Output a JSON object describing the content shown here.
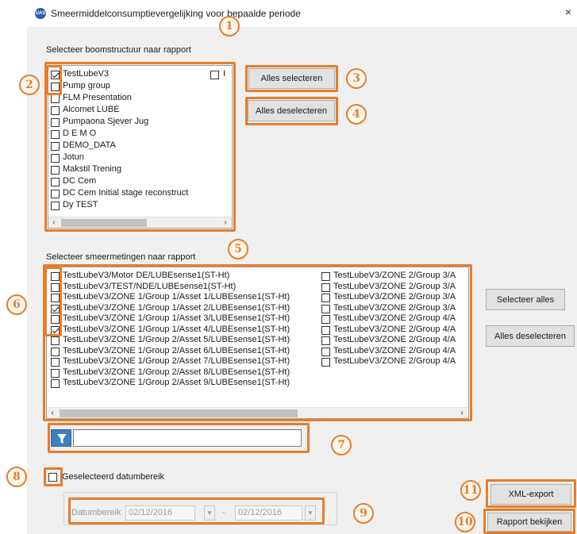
{
  "window": {
    "title": "Smeermiddelconsumptievergelijking voor bepaalde periode",
    "icon_text": "UAS",
    "close_glyph": "×"
  },
  "tree": {
    "label": "Selecteer boomstructuur naar rapport",
    "items": [
      {
        "label": "TestLubeV3",
        "checked": true
      },
      {
        "label": "Pump group",
        "checked": false
      },
      {
        "label": "FLM Presentation",
        "checked": false
      },
      {
        "label": "Alcomet LUBE",
        "checked": false
      },
      {
        "label": "Pumpaona Sjever Jug",
        "checked": false
      },
      {
        "label": "D E M O",
        "checked": false
      },
      {
        "label": "DEMO_DATA",
        "checked": false
      },
      {
        "label": "Jotun",
        "checked": false
      },
      {
        "label": "Makstil Trening",
        "checked": false
      },
      {
        "label": "DC Cem",
        "checked": false
      },
      {
        "label": "DC Cem Initial stage reconstruct",
        "checked": false
      },
      {
        "label": "Dy TEST",
        "checked": false
      }
    ],
    "extra_item": {
      "label": "I",
      "checked": false
    },
    "select_all_button": "Alles selecteren",
    "deselect_all_button": "Alles deselecteren"
  },
  "measurements": {
    "label": "Selecteer smeermetingen naar rapport",
    "left_column": [
      {
        "label": "TestLubeV3/Motor DE/LUBEsense1(ST-Ht)",
        "checked": false
      },
      {
        "label": "TestLubeV3/TEST/NDE/LUBEsense1(ST-Ht)",
        "checked": false
      },
      {
        "label": "TestLubeV3/ZONE 1/Group 1/Asset 1/LUBEsense1(ST-Ht)",
        "checked": false
      },
      {
        "label": "TestLubeV3/ZONE 1/Group 1/Asset 2/LUBEsense1(ST-Ht)",
        "checked": true
      },
      {
        "label": "TestLubeV3/ZONE 1/Group 1/Asset 3/LUBEsense1(ST-Ht)",
        "checked": false
      },
      {
        "label": "TestLubeV3/ZONE 1/Group 1/Asset 4/LUBEsense1(ST-Ht)",
        "checked": true
      },
      {
        "label": "TestLubeV3/ZONE 1/Group 2/Asset 5/LUBEsense1(ST-Ht)",
        "checked": false
      },
      {
        "label": "TestLubeV3/ZONE 1/Group 2/Asset 6/LUBEsense1(ST-Ht)",
        "checked": false
      },
      {
        "label": "TestLubeV3/ZONE 1/Group 2/Asset 7/LUBEsense1(ST-Ht)",
        "checked": false
      },
      {
        "label": "TestLubeV3/ZONE 1/Group 2/Asset 8/LUBEsense1(ST-Ht)",
        "checked": false
      },
      {
        "label": "TestLubeV3/ZONE 1/Group 2/Asset 9/LUBEsense1(ST-Ht)",
        "checked": false
      }
    ],
    "right_column": [
      {
        "label": "TestLubeV3/ZONE 2/Group 3/A",
        "checked": false
      },
      {
        "label": "TestLubeV3/ZONE 2/Group 3/A",
        "checked": false
      },
      {
        "label": "TestLubeV3/ZONE 2/Group 3/A",
        "checked": false
      },
      {
        "label": "TestLubeV3/ZONE 2/Group 3/A",
        "checked": false
      },
      {
        "label": "TestLubeV3/ZONE 2/Group 4/A",
        "checked": false
      },
      {
        "label": "TestLubeV3/ZONE 2/Group 4/A",
        "checked": false
      },
      {
        "label": "TestLubeV3/ZONE 2/Group 4/A",
        "checked": false
      },
      {
        "label": "TestLubeV3/ZONE 2/Group 4/A",
        "checked": false
      },
      {
        "label": "TestLubeV3/ZONE 2/Group 4/A",
        "checked": false
      }
    ],
    "select_all_button": "Selecteer alles",
    "deselect_all_button": "Alles deselecteren",
    "filter_value": ""
  },
  "date_range": {
    "checkbox_label": "Geselecteerd datumbereik",
    "checked": false,
    "range_label": "Datumbereik",
    "from": "02/12/2016",
    "separator": "-",
    "to": "02/12/2016",
    "dropdown_glyph": "▼"
  },
  "actions": {
    "xml_export": "XML-export",
    "view_report": "Rapport bekijken"
  },
  "annotations": [
    "1",
    "2",
    "3",
    "4",
    "5",
    "6",
    "7",
    "8",
    "9",
    "10",
    "11"
  ],
  "colors": {
    "highlight": "#e87c2a",
    "window_bg": "#f0f0f0",
    "filter_icon": "#3b7fc4"
  }
}
